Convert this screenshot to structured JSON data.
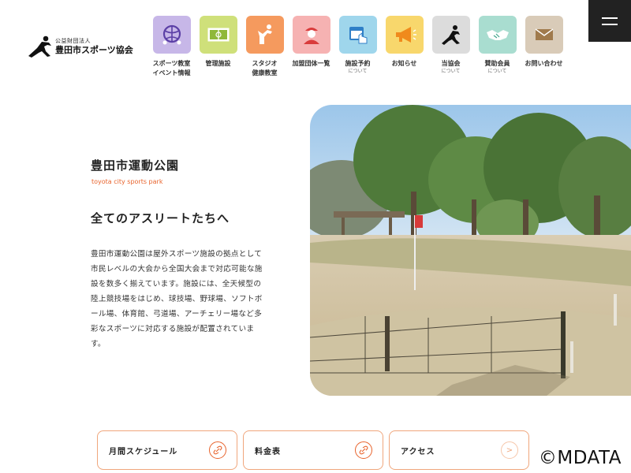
{
  "header": {
    "logo_sub": "公益財団法人",
    "logo_main": "豊田市スポーツ協会",
    "nav": [
      {
        "line1": "スポーツ教室",
        "line2": "イベント情報",
        "note": "",
        "color": "#c7b7e8",
        "icon": "sports-ball-icon"
      },
      {
        "line1": "管理施設",
        "line2": "",
        "note": "",
        "color": "#cfe07a",
        "icon": "field-icon"
      },
      {
        "line1": "スタジオ",
        "line2": "健康教室",
        "note": "",
        "color": "#f59a5e",
        "icon": "fitness-icon"
      },
      {
        "line1": "加盟団体一覧",
        "line2": "",
        "note": "",
        "color": "#f6b2b2",
        "icon": "member-icon"
      },
      {
        "line1": "施設予約",
        "line2": "",
        "note": "について",
        "color": "#9fd6ec",
        "icon": "calendar-touch-icon"
      },
      {
        "line1": "お知らせ",
        "line2": "",
        "note": "",
        "color": "#f8d76c",
        "icon": "megaphone-icon"
      },
      {
        "line1": "当協会",
        "line2": "",
        "note": "について",
        "color": "#dcdcdc",
        "icon": "association-icon"
      },
      {
        "line1": "賛助会員",
        "line2": "",
        "note": "について",
        "color": "#a9ddd0",
        "icon": "handshake-icon"
      },
      {
        "line1": "お問い合わせ",
        "line2": "",
        "note": "",
        "color": "#d9cbb8",
        "icon": "envelope-icon"
      }
    ]
  },
  "intro": {
    "title": "豊田市運動公園",
    "title_en": "toyota city sports park",
    "headline": "全てのアスリートたちへ",
    "description": "豊田市運動公園は屋外スポーツ施設の拠点として市民レベルの大会から全国大会まで対応可能な施設を数多く揃えています。施設には、全天候型の陸上競技場をはじめ、球技場、野球場、ソフトボール場、体育館、弓道場、アーチェリー場など多彩なスポーツに対応する施設が配置されています。"
  },
  "links": [
    {
      "label": "月間スケジュール",
      "icon": "link-icon"
    },
    {
      "label": "料金表",
      "icon": "link-icon"
    },
    {
      "label": "アクセス",
      "icon": "arrow-icon"
    }
  ],
  "watermark": "©MDATA",
  "colors": {
    "accent": "#e8632c",
    "menu_bg": "#222222"
  }
}
